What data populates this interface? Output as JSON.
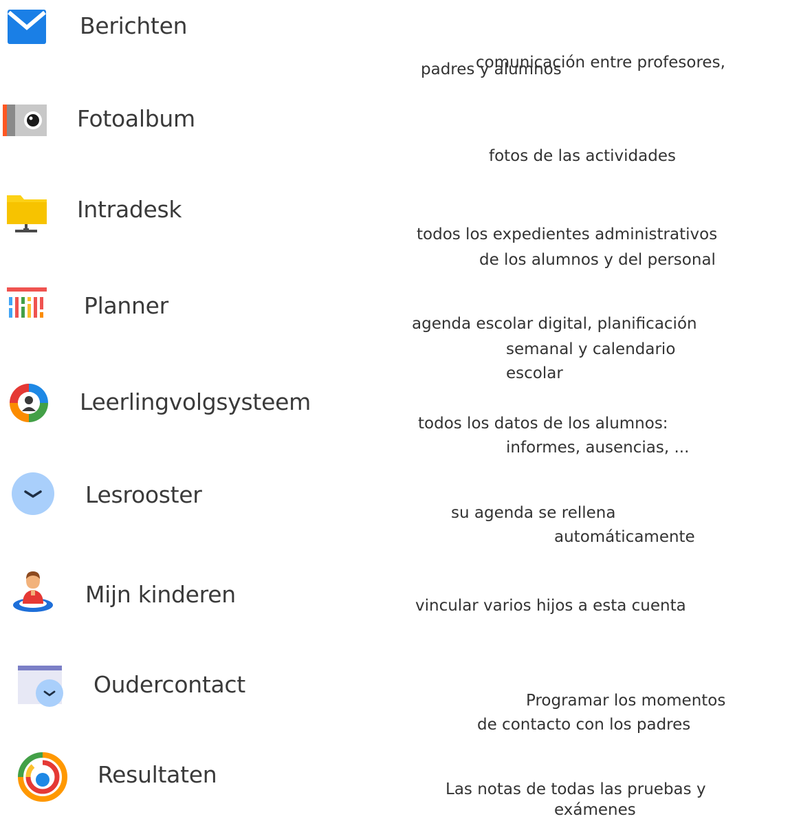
{
  "items": [
    {
      "icon": "envelope-icon",
      "label": "Berichten",
      "desc": [
        "comunicación entre profesores,",
        "padres y alumnos"
      ]
    },
    {
      "icon": "camera-icon",
      "label": "Fotoalbum",
      "desc": [
        "fotos de las actividades"
      ]
    },
    {
      "icon": "folder-icon",
      "label": "Intradesk",
      "desc": [
        "todos los expedientes administrativos",
        "de los alumnos y del personal"
      ]
    },
    {
      "icon": "planner-icon",
      "label": "Planner",
      "desc": [
        "agenda escolar digital, planificación",
        "semanal y calendario",
        "escolar"
      ]
    },
    {
      "icon": "student-tracking-icon",
      "label": "Leerlingvolgsysteem",
      "desc": [
        "todos los datos de los alumnos:",
        "informes, ausencias, ..."
      ]
    },
    {
      "icon": "clock-icon",
      "label": "Lesrooster",
      "desc": [
        "su agenda se rellena",
        "automáticamente"
      ]
    },
    {
      "icon": "child-person-icon",
      "label": "Mijn kinderen",
      "desc": [
        "vincular varios hijos a esta cuenta"
      ]
    },
    {
      "icon": "calendar-clock-icon",
      "label": "Oudercontact",
      "desc": [
        "Programar los momentos",
        "de contacto con los padres"
      ]
    },
    {
      "icon": "results-ring-icon",
      "label": "Resultaten",
      "desc": [
        "Las notas de todas las pruebas y",
        "exámenes"
      ]
    }
  ],
  "colors": {
    "envelope": "#1a7fe6",
    "folder": "#fcd116",
    "clock": "#a9cffb",
    "child_shirt": "#e53935",
    "child_base": "#1e6fd9"
  }
}
